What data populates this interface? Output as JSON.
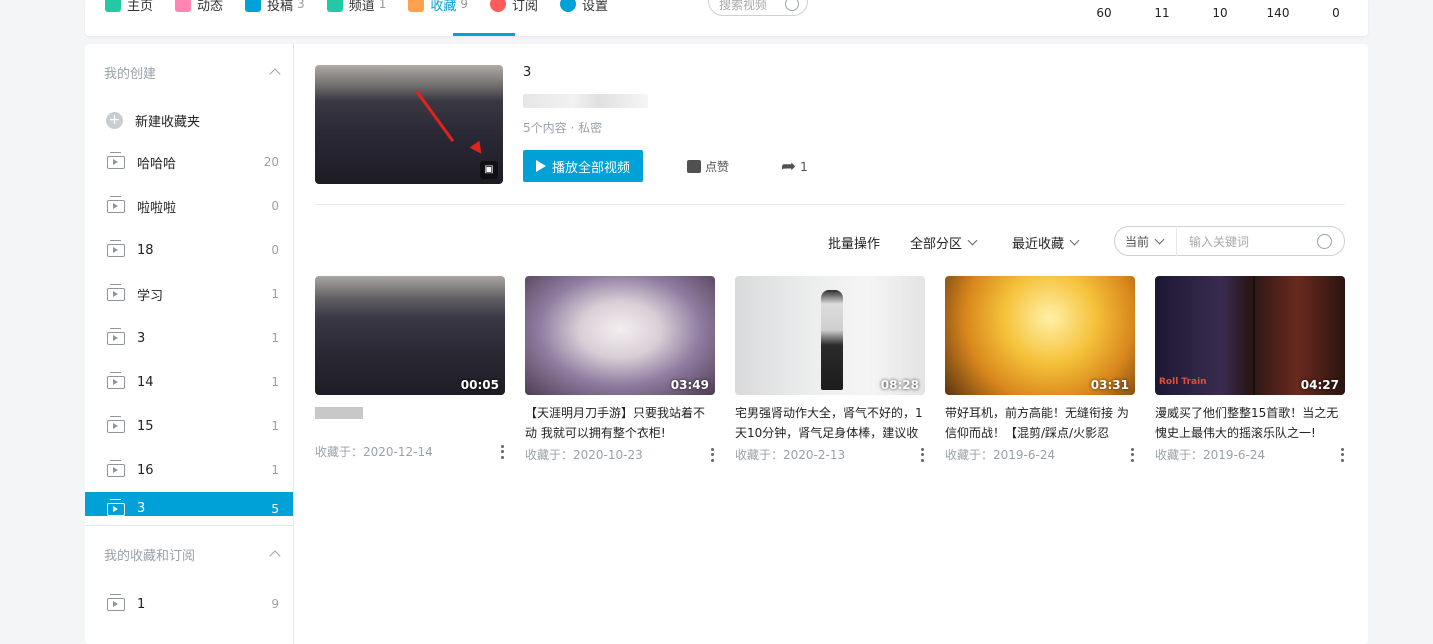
{
  "nav": {
    "items": [
      {
        "label": "主页",
        "count": "",
        "color": "#23c9a2"
      },
      {
        "label": "动态",
        "count": "",
        "color": "#ff85b3"
      },
      {
        "label": "投稿",
        "count": "3",
        "color": "#00a1d6"
      },
      {
        "label": "频道",
        "count": "1",
        "color": "#23c9a2"
      },
      {
        "label": "收藏",
        "count": "9",
        "color": "#ffa24f"
      },
      {
        "label": "订阅",
        "count": "",
        "color": "#ff5c5c"
      },
      {
        "label": "设置",
        "count": "",
        "color": "#00a1d6"
      }
    ],
    "search_placeholder": "搜索视频",
    "stats": [
      "60",
      "11",
      "10",
      "140",
      "0"
    ]
  },
  "sidebar": {
    "created_title": "我的创建",
    "new_folder": "新建收藏夹",
    "folders": [
      {
        "name": "哈哈哈",
        "count": "20"
      },
      {
        "name": "啦啦啦",
        "count": "0"
      },
      {
        "name": "18",
        "count": "0"
      },
      {
        "name": "学习",
        "count": "1"
      },
      {
        "name": "3",
        "count": "1"
      },
      {
        "name": "14",
        "count": "1"
      },
      {
        "name": "15",
        "count": "1"
      },
      {
        "name": "16",
        "count": "1"
      }
    ],
    "selected": {
      "name": "3",
      "count": "5"
    },
    "subscribed_title": "我的收藏和订阅",
    "subscribed": [
      {
        "name": "1",
        "count": "9"
      }
    ]
  },
  "folder": {
    "title": "3",
    "meta": "5个内容 · 私密",
    "play_all": "播放全部视频",
    "like": "点赞",
    "share_count": "1"
  },
  "toolbar": {
    "batch": "批量操作",
    "zone": "全部分区",
    "sort": "最近收藏",
    "scope": "当前",
    "keyword_placeholder": "输入关键词"
  },
  "videos": [
    {
      "duration": "00:05",
      "title": "",
      "date_label": "收藏于：",
      "date": "2020-12-14"
    },
    {
      "duration": "03:49",
      "title": "【天涯明月刀手游】只要我站着不动 我就可以拥有整个衣柜!",
      "date_label": "收藏于：",
      "date": "2020-10-23"
    },
    {
      "duration": "08:28",
      "title": "宅男强肾动作大全，肾气不好的，1天10分钟，肾气足身体棒，建议收",
      "date_label": "收藏于：",
      "date": "2020-2-13"
    },
    {
      "duration": "03:31",
      "title": "带好耳机，前方高能！无缝衔接 为信仰而战！【混剪/踩点/火影忍",
      "date_label": "收藏于：",
      "date": "2019-6-24"
    },
    {
      "duration": "04:27",
      "title": "漫威买了他们整整15首歌！当之无愧史上最伟大的摇滚乐队之一!",
      "date_label": "收藏于：",
      "date": "2019-6-24",
      "thumb_text": "Roll Train"
    }
  ],
  "colors": {
    "accent": "#00a1d6"
  }
}
